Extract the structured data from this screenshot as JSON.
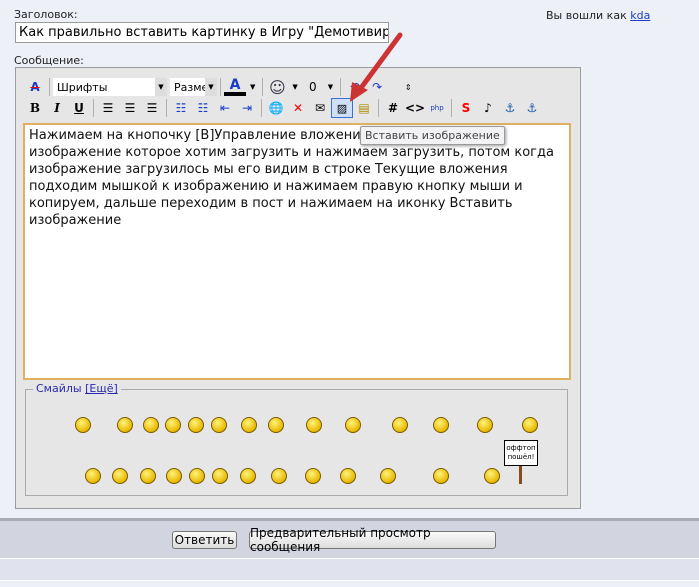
{
  "subject": {
    "label": "Заголовок:",
    "value": "Как правильно вставить картинку в Игру \"Демотивир"
  },
  "login": {
    "prefix": "Вы вошли как",
    "user": "kda"
  },
  "message": {
    "label": "Сообщение:"
  },
  "toolbar": {
    "font_select": "Шрифты",
    "size_select": "Разме",
    "tooltip": "Вставить изображение"
  },
  "body_lines": [
    "Нажимаем на кнопочку [B]Управление вложени",
    "изображение которое хотим загрузить и нажимаем загрузить, потом когда",
    "изображение загрузилось мы его видим в строке Текущие вложения",
    "подходим мышкой к изображению и нажимаем правую кнопку мыши и",
    "копируем, дальше переходим в пост и нажимаем на иконку Вставить",
    "изображение"
  ],
  "smilies": {
    "label": "Смайлы",
    "more": "[Ещё]",
    "sign_text": "оффтоп пошёл!"
  },
  "buttons": {
    "reply": "Ответить",
    "preview": "Предварительный просмотр сообщения"
  },
  "colors": {
    "accent_link": "#1a3cc8",
    "textarea_border": "#e0b060",
    "arrow": "#cc3333"
  }
}
